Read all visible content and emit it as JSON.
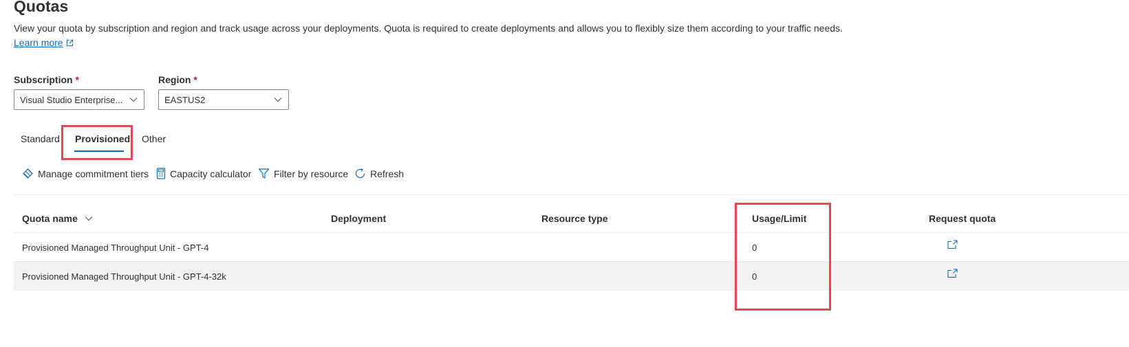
{
  "page": {
    "title": "Quotas",
    "description": "View your quota by subscription and region and track usage across your deployments. Quota is required to create deployments and allows you to flexibly size them according to your traffic needs.",
    "learn_more": "Learn more"
  },
  "filters": {
    "subscription": {
      "label": "Subscription",
      "required": "*",
      "value": "Visual Studio Enterprise..."
    },
    "region": {
      "label": "Region",
      "required": "*",
      "value": "EASTUS2"
    }
  },
  "tabs": [
    {
      "label": "Standard",
      "selected": false
    },
    {
      "label": "Provisioned",
      "selected": true
    },
    {
      "label": "Other",
      "selected": false
    }
  ],
  "toolbar": {
    "manage_commitment_tiers": "Manage commitment tiers",
    "capacity_calculator": "Capacity calculator",
    "filter_by_resource": "Filter by resource",
    "refresh": "Refresh"
  },
  "table": {
    "columns": {
      "quota_name": "Quota name",
      "deployment": "Deployment",
      "resource_type": "Resource type",
      "usage_limit": "Usage/Limit",
      "request_quota": "Request quota"
    },
    "rows": [
      {
        "quota_name": "Provisioned Managed Throughput Unit - GPT-4",
        "deployment": "",
        "resource_type": "",
        "usage_limit": "0"
      },
      {
        "quota_name": "Provisioned Managed Throughput Unit - GPT-4-32k",
        "deployment": "",
        "resource_type": "",
        "usage_limit": "0"
      }
    ]
  },
  "colors": {
    "accent": "#0f6cbd",
    "highlight": "#e5484d",
    "required": "#a4262c",
    "row_alt": "#f3f2f1"
  }
}
